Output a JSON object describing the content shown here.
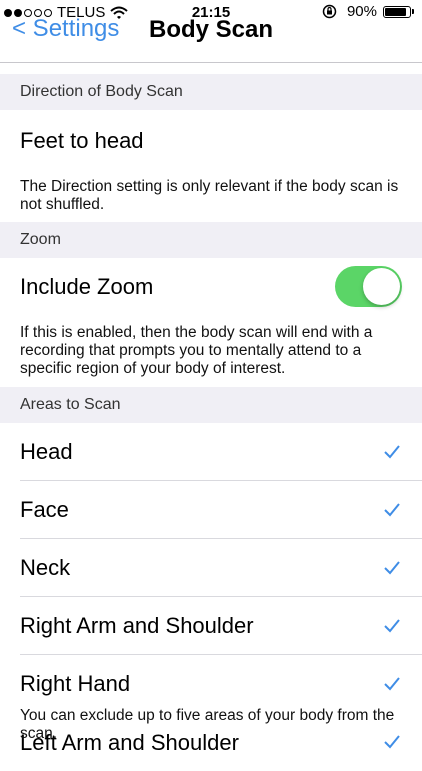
{
  "status_bar": {
    "carrier": "TELUS",
    "time": "21:15",
    "battery_percent": "90%",
    "battery_level": 0.9,
    "signal_bars_filled": 2,
    "icons": [
      "signal-dots-icon",
      "wifi-icon",
      "rotation-lock-icon",
      "battery-icon"
    ]
  },
  "nav": {
    "back_label": "< Settings",
    "title": "Body Scan"
  },
  "sections": {
    "direction": {
      "header": "Direction of Body Scan",
      "value": "Feet to head",
      "footer": "The Direction setting is only relevant if the body scan is not shuffled."
    },
    "zoom": {
      "header": "Zoom",
      "toggle_label": "Include Zoom",
      "toggle_on": true,
      "footer": "If this is enabled, then the body scan will end with a recording that prompts you to mentally attend to a specific region of your body of interest."
    },
    "areas": {
      "header": "Areas to Scan",
      "items": [
        {
          "label": "Head",
          "checked": true
        },
        {
          "label": "Face",
          "checked": true
        },
        {
          "label": "Neck",
          "checked": true
        },
        {
          "label": "Right Arm and Shoulder",
          "checked": true
        },
        {
          "label": "Right Hand",
          "checked": true
        },
        {
          "label": "Left Arm and Shoulder",
          "checked": true
        }
      ],
      "overlay_note": "You can exclude up to five areas of your body from the scan."
    }
  },
  "colors": {
    "accent": "#3f8de6",
    "toggle_on": "#5bd567",
    "section_bg": "#f0eff5"
  }
}
